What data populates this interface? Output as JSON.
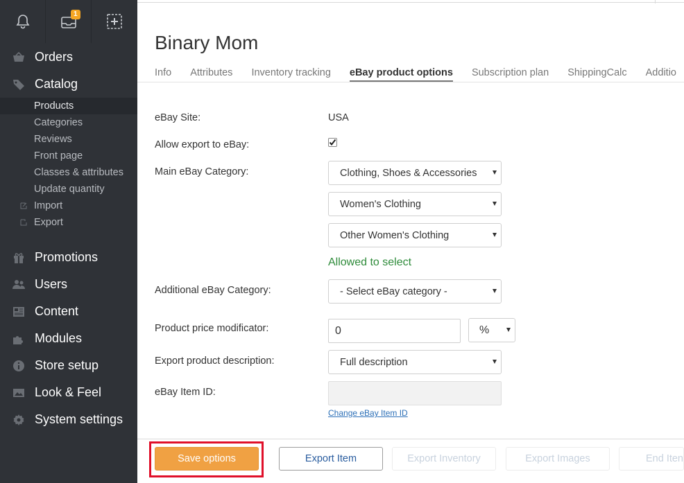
{
  "topbar": {
    "badge": "1"
  },
  "nav": {
    "orders": "Orders",
    "catalog": "Catalog",
    "catalog_sub": {
      "products": "Products",
      "categories": "Categories",
      "reviews": "Reviews",
      "front_page": "Front page",
      "classes": "Classes & attributes",
      "update_qty": "Update quantity",
      "import": "Import",
      "export": "Export"
    },
    "promotions": "Promotions",
    "users": "Users",
    "content": "Content",
    "modules": "Modules",
    "store_setup": "Store setup",
    "look_feel": "Look & Feel",
    "system_settings": "System settings"
  },
  "page": {
    "title": "Binary Mom"
  },
  "tabs": [
    "Info",
    "Attributes",
    "Inventory tracking",
    "eBay product options",
    "Subscription plan",
    "ShippingCalc",
    "Additio"
  ],
  "form": {
    "ebay_site_label": "eBay Site:",
    "ebay_site_value": "USA",
    "allow_export_label": "Allow export to eBay:",
    "allow_export_checked": true,
    "main_category_label": "Main eBay Category:",
    "main_category_1": "Clothing, Shoes & Accessories",
    "main_category_2": "Women's Clothing",
    "main_category_3": "Other Women's Clothing",
    "allowed_text": "Allowed to select",
    "additional_category_label": "Additional eBay Category:",
    "additional_category_value": "- Select eBay category -",
    "price_mod_label": "Product price modificator:",
    "price_mod_value": "0",
    "price_mod_unit": "%",
    "export_desc_label": "Export product description:",
    "export_desc_value": "Full description",
    "item_id_label": "eBay Item ID:",
    "item_id_value": "",
    "change_item_id_link": "Change eBay Item ID"
  },
  "footer": {
    "save": "Save options",
    "export_item": "Export Item",
    "export_inventory": "Export Inventory",
    "export_images": "Export Images",
    "end_item": "End Iten"
  },
  "colors": {
    "accent": "#f0a143",
    "highlight": "#e0102a",
    "success": "#2e8b3a",
    "link": "#2c6fb7",
    "sidebar": "#2f3237"
  }
}
